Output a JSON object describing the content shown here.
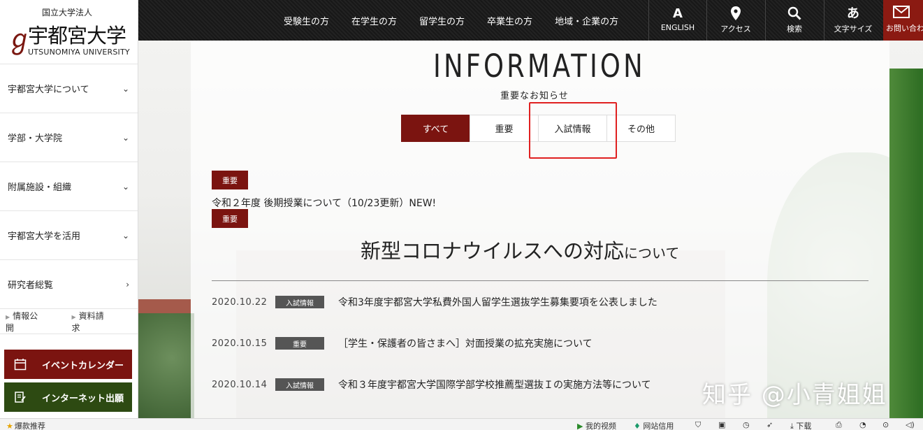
{
  "logo": {
    "corp": "国立大学法人",
    "name": "宇都宮大学",
    "en": "UTSUNOMIYA UNIVERSITY",
    "mark": "ℊ"
  },
  "sidebar": {
    "items": [
      {
        "label": "宇都宮大学について",
        "chevron": "⌄"
      },
      {
        "label": "学部・大学院",
        "chevron": "⌄"
      },
      {
        "label": "附属施設・組織",
        "chevron": "⌄"
      },
      {
        "label": "宇都宮大学を活用",
        "chevron": "⌄"
      },
      {
        "label": "研究者総覧",
        "chevron": "›"
      }
    ],
    "links": [
      "情報公開",
      "資料請求"
    ],
    "event_button": "イベントカレンダー",
    "apply_button": "インターネット出願"
  },
  "topnav": [
    "受験生の方",
    "在学生の方",
    "留学生の方",
    "卒業生の方",
    "地域・企業の方"
  ],
  "tools": [
    {
      "glyph": "A",
      "label": "ENGLISH"
    },
    {
      "glyph": "⚲",
      "label": "アクセス"
    },
    {
      "glyph": "⚲",
      "label": "検索"
    },
    {
      "glyph": "あ",
      "label": "文字サイズ"
    }
  ],
  "contact": {
    "glyph": "✉",
    "label": "お問い合わせ"
  },
  "main": {
    "title": "INFORMATION",
    "subtitle": "重要なお知らせ",
    "tabs": [
      "すべて",
      "重要",
      "入試情報",
      "その他"
    ],
    "tag_important": "重要",
    "notice": "令和２年度 後期授業について（10/23更新）NEW!",
    "covid_main": "新型コロナウイルスへの対応",
    "covid_suffix": "について",
    "news": [
      {
        "date": "2020.10.22",
        "category": "入試情報",
        "title": "令和3年度宇都宮大学私費外国人留学生選抜学生募集要項を公表しました"
      },
      {
        "date": "2020.10.15",
        "category": "重要",
        "title": "［学生・保護者の皆さまへ］対面授業の拡充実施について"
      },
      {
        "date": "2020.10.14",
        "category": "入試情報",
        "title": "令和３年度宇都宮大学国際学部学校推薦型選抜Ｉの実施方法等について"
      }
    ]
  },
  "watermark": "知乎 @小青姐姐",
  "statusbar": {
    "left": "爆款推荐",
    "items": [
      "我的视频",
      "网站信用",
      "下载"
    ]
  },
  "colors": {
    "brand": "#7b1410",
    "event_btn": "#7b1410",
    "apply_btn": "#2d4a12",
    "highlight": "#e02020"
  }
}
